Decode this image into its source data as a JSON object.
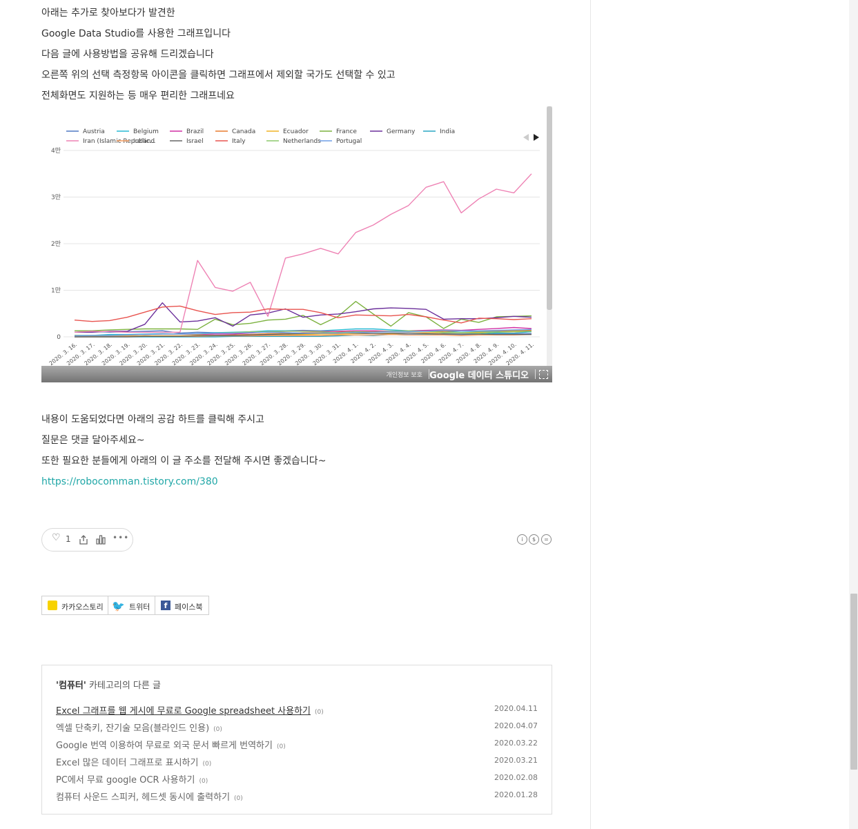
{
  "intro_lines": [
    "아래는 추가로 찾아보다가 발견한",
    "Google Data Studio를 사용한 그래프입니다",
    "다음 글에 사용방법을 공유해 드리겠습니다",
    "오른쪽 위의 선택 측정항목 아이콘을 클릭하면 그래프에서 제외할 국가도 선택할 수 있고",
    "전체화면도 지원하는 등 매우 편리한 그래프네요"
  ],
  "outro_lines": [
    "내용이 도움되었다면 아래의 공감 하트를 클릭해 주시고",
    "질문은 댓글 달아주세요~",
    "또한 필요한 분들에게 아래의 이 글 주소를 전달해 주시면 좋겠습니다~"
  ],
  "post_url": "https://robocomman.tistory.com/380",
  "embed_footer": {
    "privacy": "개인정보 보호",
    "brand": "Google 데이터 스튜디오"
  },
  "reactions": {
    "like_count": "1",
    "more": "•••"
  },
  "sns_buttons": {
    "kakao": "카카오스토리",
    "twitter": "트위터",
    "facebook": "페이스북"
  },
  "related": {
    "category": "'컴퓨터'",
    "title_suffix": " 카테고리의 다른 글",
    "items": [
      {
        "title": "Excel 그래프를 웹 게시에 무료로 Google spreadsheet 사용하기",
        "count": "(0)",
        "date": "2020.04.11"
      },
      {
        "title": "엑셀 단축키, 잔기술 모음(블라인드 인용)",
        "count": "(0)",
        "date": "2020.04.07"
      },
      {
        "title": "Google 번역 이용하여 무료로 외국 문서 빠르게 번역하기",
        "count": "(0)",
        "date": "2020.03.22"
      },
      {
        "title": "Excel 많은 데이터 그래프로 표시하기",
        "count": "(0)",
        "date": "2020.03.21"
      },
      {
        "title": "PC에서 무료 google OCR 사용하기",
        "count": "(0)",
        "date": "2020.02.08"
      },
      {
        "title": "컴퓨터 사운드 스피커, 헤드셋 동시에 출력하기",
        "count": "(0)",
        "date": "2020.01.28"
      }
    ]
  },
  "chart_data": {
    "type": "line",
    "y_ticks": [
      "0",
      "1만",
      "2만",
      "3만",
      "4만"
    ],
    "ylim": [
      0,
      40000
    ],
    "grid": true,
    "legend_position": "top",
    "x": [
      "2020. 3. 16.",
      "2020. 3. 17.",
      "2020. 3. 18.",
      "2020. 3. 19.",
      "2020. 3. 20.",
      "2020. 3. 21.",
      "2020. 3. 22.",
      "2020. 3. 23.",
      "2020. 3. 24.",
      "2020. 3. 25.",
      "2020. 3. 26.",
      "2020. 3. 27.",
      "2020. 3. 28.",
      "2020. 3. 29.",
      "2020. 3. 30.",
      "2020. 3. 31.",
      "2020. 4. 1.",
      "2020. 4. 2.",
      "2020. 4. 3.",
      "2020. 4. 4.",
      "2020. 4. 5.",
      "2020. 4. 6.",
      "2020. 4. 7.",
      "2020. 4. 8.",
      "2020. 4. 9.",
      "2020. 4. 10.",
      "2020. 4. 11."
    ],
    "series": [
      {
        "name": "Austria",
        "color": "#4e79c4",
        "values": [
          1000,
          1200,
          1000,
          1100,
          1200,
          1300,
          800,
          1000,
          900,
          900,
          1000,
          1100,
          900,
          800,
          800,
          700,
          800,
          700,
          600,
          500,
          500,
          400,
          400,
          500,
          600,
          600,
          700
        ]
      },
      {
        "name": "Belgium",
        "color": "#26b8d3",
        "values": [
          300,
          300,
          500,
          500,
          600,
          700,
          600,
          700,
          900,
          1000,
          1100,
          1300,
          1300,
          1400,
          1300,
          1500,
          1700,
          1700,
          1500,
          1300,
          1300,
          1200,
          1000,
          1100,
          1200,
          1300,
          1400
        ]
      },
      {
        "name": "Brazil",
        "color": "#d12fa3",
        "values": [
          300,
          200,
          300,
          400,
          500,
          600,
          600,
          500,
          600,
          600,
          800,
          1100,
          1200,
          1300,
          1200,
          1200,
          1300,
          1300,
          1200,
          1300,
          1400,
          1500,
          1400,
          1600,
          1800,
          2000,
          1800
        ]
      },
      {
        "name": "Canada",
        "color": "#e87c2e",
        "values": [
          100,
          100,
          100,
          100,
          200,
          200,
          200,
          300,
          300,
          400,
          500,
          700,
          700,
          900,
          900,
          1000,
          1100,
          1100,
          1200,
          1200,
          1200,
          1200,
          1300,
          1300,
          1300,
          1300,
          1400
        ]
      },
      {
        "name": "Ecuador",
        "color": "#f0b323",
        "values": [
          100,
          100,
          100,
          200,
          200,
          200,
          200,
          300,
          300,
          300,
          400,
          400,
          400,
          500,
          600,
          600,
          700,
          700,
          700,
          800,
          900,
          900,
          900,
          1000,
          1000,
          1100,
          1100
        ]
      },
      {
        "name": "France",
        "color": "#7bb13e",
        "values": [
          1300,
          1300,
          1500,
          1600,
          1700,
          1700,
          1700,
          1600,
          3800,
          2600,
          2900,
          3600,
          3800,
          4600,
          2600,
          4400,
          7600,
          4900,
          2300,
          5200,
          4300,
          1800,
          3800,
          3100,
          4300,
          4400,
          4500
        ]
      },
      {
        "name": "Germany",
        "color": "#6a2e9a",
        "values": [
          1000,
          1000,
          1200,
          1200,
          2700,
          7300,
          3200,
          3400,
          4100,
          2300,
          4700,
          5100,
          6000,
          4200,
          4700,
          4900,
          5400,
          6000,
          6200,
          6100,
          5900,
          3800,
          3900,
          3900,
          4100,
          4400,
          4200
        ]
      },
      {
        "name": "India",
        "color": "#29a6c4",
        "values": [
          0,
          0,
          0,
          0,
          0,
          0,
          0,
          0,
          0,
          100,
          100,
          100,
          100,
          100,
          100,
          200,
          400,
          300,
          500,
          400,
          500,
          700,
          600,
          600,
          800,
          800,
          1100
        ]
      },
      {
        "name": "Iran (Islamic Republic...",
        "color": "#ee82b4",
        "values": [
          1000,
          1200,
          1100,
          1000,
          1000,
          1000,
          1000,
          16400,
          10600,
          9800,
          11700,
          4400,
          16900,
          17800,
          19000,
          17800,
          22400,
          24000,
          26300,
          28200,
          32100,
          33300,
          26600,
          29600,
          31700,
          30900,
          35000
        ]
      },
      {
        "name": "Ireland",
        "color": "#f49a5b",
        "values": [
          0,
          0,
          0,
          100,
          100,
          100,
          100,
          100,
          200,
          200,
          200,
          300,
          300,
          300,
          300,
          400,
          400,
          400,
          500,
          400,
          400,
          400,
          300,
          400,
          400,
          400,
          500
        ]
      },
      {
        "name": "Israel",
        "color": "#666666",
        "values": [
          0,
          0,
          0,
          0,
          100,
          100,
          100,
          200,
          300,
          300,
          400,
          500,
          600,
          700,
          800,
          900,
          800,
          700,
          800,
          800,
          700,
          600,
          600,
          600,
          500,
          500,
          500
        ]
      },
      {
        "name": "Italy",
        "color": "#e8534e",
        "values": [
          3600,
          3300,
          3500,
          4200,
          5300,
          6400,
          6600,
          5600,
          4800,
          5200,
          5300,
          6000,
          5900,
          5900,
          5200,
          4100,
          4700,
          4600,
          4500,
          4800,
          4300,
          3600,
          3000,
          4000,
          3900,
          3700,
          3900
        ]
      },
      {
        "name": "Netherlands",
        "color": "#8bc86c",
        "values": [
          300,
          300,
          300,
          400,
          500,
          600,
          600,
          600,
          800,
          900,
          1100,
          1100,
          1200,
          1200,
          1100,
          900,
          1100,
          1000,
          1200,
          1300,
          1200,
          1000,
          900,
          800,
          1000,
          1200,
          1200
        ]
      },
      {
        "name": "Portugal",
        "color": "#6e9ee6",
        "values": [
          200,
          300,
          300,
          400,
          500,
          600,
          600,
          700,
          800,
          800,
          900,
          1000,
          900,
          800,
          800,
          800,
          900,
          1000,
          1100,
          1100,
          1200,
          1400,
          1300,
          1300,
          1400,
          1500,
          1600
        ]
      }
    ]
  }
}
